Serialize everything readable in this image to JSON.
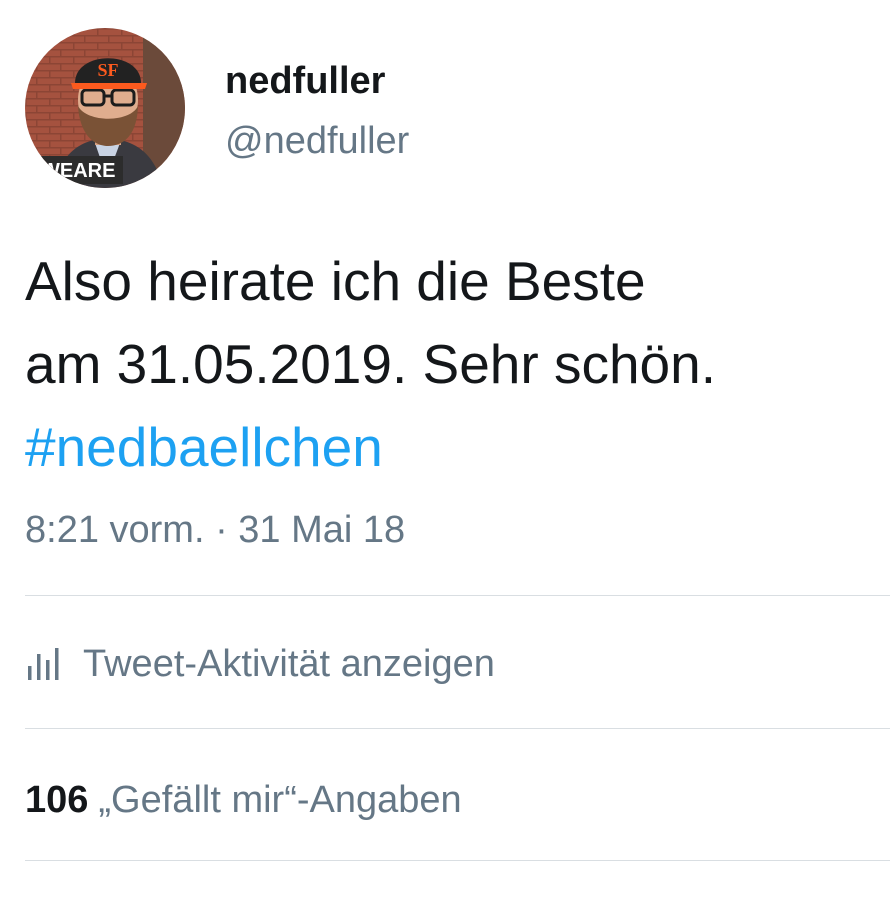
{
  "author": {
    "display_name": "nedfuller",
    "handle": "@nedfuller",
    "avatar_badge_text": "WEARE"
  },
  "tweet": {
    "text_lines": [
      "Also heirate ich die Beste",
      "am 31.05.2019. Sehr schön."
    ],
    "hashtag": "#nedbaellchen",
    "timestamp": "8:21 vorm. · 31 Mai 18"
  },
  "activity": {
    "icon": "bar-chart-icon",
    "label": "Tweet-Aktivität anzeigen"
  },
  "likes": {
    "count": "106",
    "label": "„Gefällt mir“-Angaben"
  },
  "colors": {
    "text": "#14171a",
    "secondary": "#657786",
    "link": "#1da1f2",
    "divider": "#d9dee2"
  }
}
